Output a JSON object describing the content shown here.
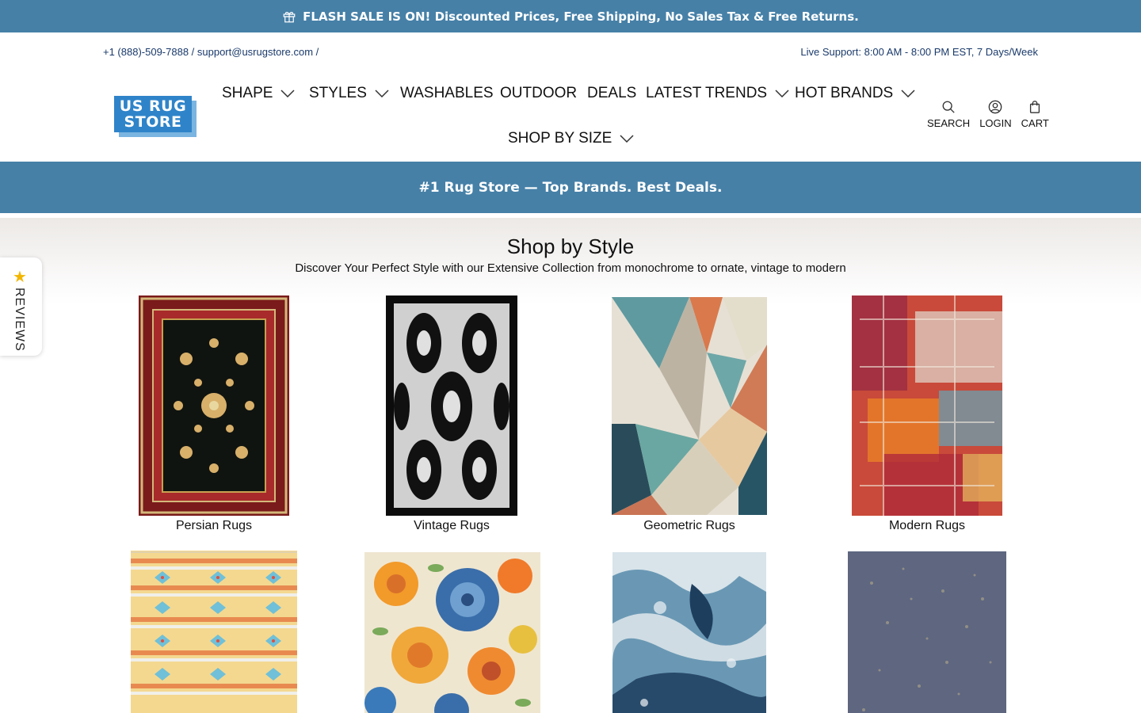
{
  "announcement": {
    "text": "FLASH SALE IS ON! Discounted Prices, Free Shipping, No Sales Tax & Free Returns."
  },
  "utility": {
    "contact": "+1 (888)-509-7888 / support@usrugstore.com /",
    "support_hours": "Live Support: 8:00 AM - 8:00 PM EST, 7 Days/Week"
  },
  "logo": {
    "line1": "US RUG",
    "line2": "STORE"
  },
  "nav": [
    {
      "label": "SHAPE",
      "dropdown": true
    },
    {
      "label": "STYLES",
      "dropdown": true
    },
    {
      "label": "WASHABLES",
      "dropdown": false
    },
    {
      "label": "OUTDOOR",
      "dropdown": false
    },
    {
      "label": "DEALS",
      "dropdown": false
    },
    {
      "label": "LATEST TRENDS",
      "dropdown": true
    },
    {
      "label": "HOT BRANDS",
      "dropdown": true
    },
    {
      "label": "SHOP BY SIZE",
      "dropdown": true
    }
  ],
  "header_icons": {
    "search": "SEARCH",
    "login": "LOGIN",
    "cart": "CART"
  },
  "tagline": "#1 Rug Store — Top Brands. Best Deals.",
  "section": {
    "title": "Shop by Style",
    "subtitle": "Discover Your Perfect Style with our Extensive Collection from monochrome to ornate, vintage to modern"
  },
  "styles": [
    {
      "label": "Persian Rugs",
      "icon": "persian-rug"
    },
    {
      "label": "Vintage Rugs",
      "icon": "vintage-rug"
    },
    {
      "label": "Geometric Rugs",
      "icon": "geometric-rug"
    },
    {
      "label": "Modern Rugs",
      "icon": "modern-rug"
    },
    {
      "label": "",
      "icon": "southwestern-rug"
    },
    {
      "label": "",
      "icon": "floral-rug"
    },
    {
      "label": "",
      "icon": "abstract-blue-rug"
    },
    {
      "label": "",
      "icon": "gray-speckled-rug"
    }
  ],
  "reviews_tab": {
    "label": "REVIEWS"
  },
  "colors": {
    "brand_blue": "#4680a7",
    "logo_blue": "#2f84c9",
    "link_navy": "#1a3a6b"
  }
}
